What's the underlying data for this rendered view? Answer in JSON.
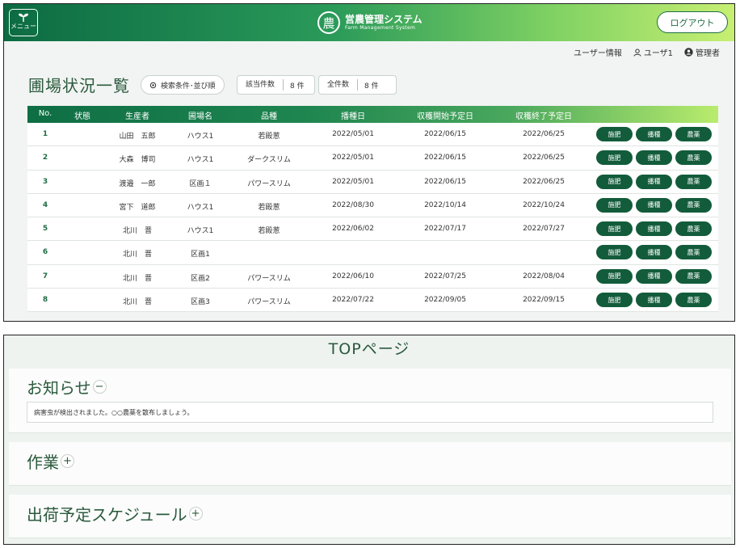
{
  "header": {
    "menu_label": "メニュー",
    "logo_char": "農",
    "app_title": "営農管理システム",
    "app_subtitle": "Farm Management System",
    "logout_label": "ログアウト",
    "gradient": [
      "#0c6b43",
      "#2a9a59",
      "#7fd163",
      "#c7ef73"
    ]
  },
  "userbar": {
    "user_info": "ユーザー情報",
    "user_name": "ユーザ1",
    "role": "管理者"
  },
  "field_list": {
    "title": "圃場状況一覧",
    "filter_label": "検索条件･並び順",
    "match_count_label": "該当件数",
    "match_count_value": "8 件",
    "total_count_label": "全件数",
    "total_count_value": "8 件",
    "columns": [
      "No.",
      "状態",
      "生産者",
      "圃場名",
      "品種",
      "播種日",
      "収穫開始予定日",
      "収穫終了予定日"
    ],
    "action_labels": [
      "施肥",
      "播種",
      "農薬"
    ],
    "rows": [
      {
        "no": "1",
        "status": "",
        "producer": "山田　五郎",
        "field": "ハウス1",
        "variety": "若殿葱",
        "planted": "2022/05/01",
        "harvest_start": "2022/06/15",
        "harvest_end": "2022/06/25"
      },
      {
        "no": "2",
        "status": "",
        "producer": "大森　博司",
        "field": "ハウス1",
        "variety": "ダークスリム",
        "planted": "2022/05/01",
        "harvest_start": "2022/06/15",
        "harvest_end": "2022/06/25"
      },
      {
        "no": "3",
        "status": "",
        "producer": "渡邉　一郎",
        "field": "区画１",
        "variety": "パワースリム",
        "planted": "2022/05/01",
        "harvest_start": "2022/06/15",
        "harvest_end": "2022/06/25"
      },
      {
        "no": "4",
        "status": "",
        "producer": "宮下　道郎",
        "field": "ハウス1",
        "variety": "若殿葱",
        "planted": "2022/08/30",
        "harvest_start": "2022/10/14",
        "harvest_end": "2022/10/24"
      },
      {
        "no": "5",
        "status": "",
        "producer": "北川　晋",
        "field": "ハウス1",
        "variety": "若殿葱",
        "planted": "2022/06/02",
        "harvest_start": "2022/07/17",
        "harvest_end": "2022/07/27"
      },
      {
        "no": "6",
        "status": "",
        "producer": "北川　晋",
        "field": "区画1",
        "variety": "",
        "planted": "",
        "harvest_start": "",
        "harvest_end": ""
      },
      {
        "no": "7",
        "status": "",
        "producer": "北川　晋",
        "field": "区画2",
        "variety": "パワースリム",
        "planted": "2022/06/10",
        "harvest_start": "2022/07/25",
        "harvest_end": "2022/08/04"
      },
      {
        "no": "8",
        "status": "",
        "producer": "北川　晋",
        "field": "区画3",
        "variety": "パワースリム",
        "planted": "2022/07/22",
        "harvest_start": "2022/09/05",
        "harvest_end": "2022/09/15"
      }
    ]
  },
  "top_page": {
    "title": "TOPページ",
    "notice": {
      "title": "お知らせ",
      "toggle": "−",
      "message": "病害虫が検出されました。○○農薬を散布しましょう。"
    },
    "work": {
      "title": "作業",
      "toggle": "+"
    },
    "shipping": {
      "title": "出荷予定スケジュール",
      "toggle": "+"
    }
  }
}
